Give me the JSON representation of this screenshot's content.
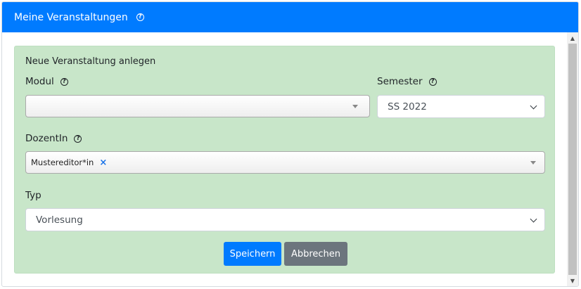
{
  "header": {
    "title": "Meine Veranstaltungen"
  },
  "form": {
    "title": "Neue Veranstaltung anlegen",
    "modul": {
      "label": "Modul",
      "value": ""
    },
    "semester": {
      "label": "Semester",
      "value": "SS 2022"
    },
    "dozent": {
      "label": "DozentIn",
      "chips": [
        "Mustereditor*in"
      ]
    },
    "typ": {
      "label": "Typ",
      "value": "Vorlesung"
    }
  },
  "actions": {
    "save": "Speichern",
    "cancel": "Abbrechen"
  },
  "icons": {
    "help": "question-circle-icon",
    "chip_remove": "close-icon",
    "dropdown": "chevron-down-icon",
    "scroll_up": "arrow-up-icon",
    "scroll_down": "arrow-down-icon"
  },
  "colors": {
    "header": "#007bff",
    "form_bg": "#c8e6c9",
    "primary": "#007bff",
    "secondary": "#6c757d"
  }
}
